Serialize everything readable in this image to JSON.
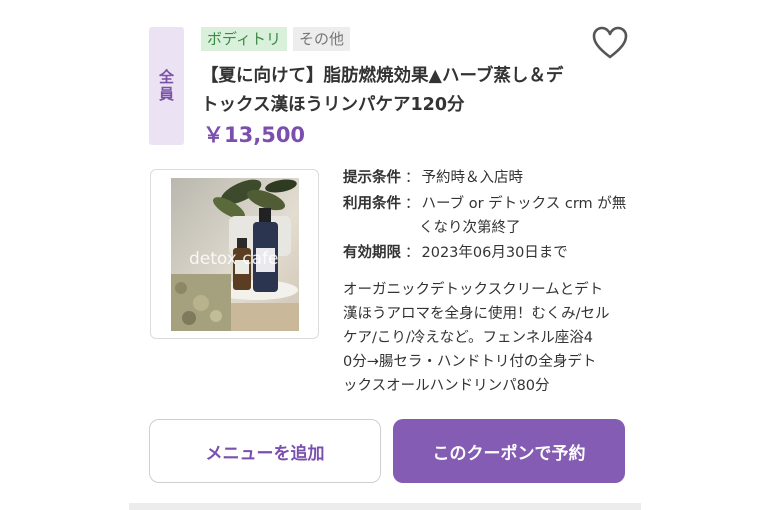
{
  "coupon": {
    "target": "全員",
    "tags": [
      "ボディトリ",
      "その他"
    ],
    "title_line1": "【夏に向けて】脂肪燃焼効果▲ハーブ蒸し＆デ",
    "title_line2": "トックス漢ほうリンパケア120分",
    "price": "￥13,500",
    "favorite_icon": "heart-outline-icon",
    "image_overlay_text": "detox cafe",
    "conditions": [
      {
        "key": "提示条件",
        "sep": "：",
        "value": "予約時＆入店時"
      },
      {
        "key": "利用条件",
        "sep": "：",
        "value": "ハーブ or デトックス crm が無",
        "value2": "くなり次第終了"
      },
      {
        "key": "有効期限",
        "sep": "：",
        "value": "2023年06月30日まで"
      }
    ],
    "description": [
      "オーガニックデトックスクリームとデト",
      "漢ほうアロマを全身に使用！むくみ/セル",
      "ケア/こり/冷えなど。フェンネル座浴4",
      "0分→腸セラ・ハンドトリ付の全身デト",
      "ックスオールハンドリンパ80分"
    ]
  },
  "actions": {
    "add_menu": "メニューを追加",
    "reserve": "このクーポンで予約"
  },
  "colors": {
    "accent": "#845cb3",
    "price": "#7a4fae",
    "tag_green": "#d9f0db",
    "tag_gray": "#ededed",
    "badge_bg": "#ebe3f3"
  }
}
